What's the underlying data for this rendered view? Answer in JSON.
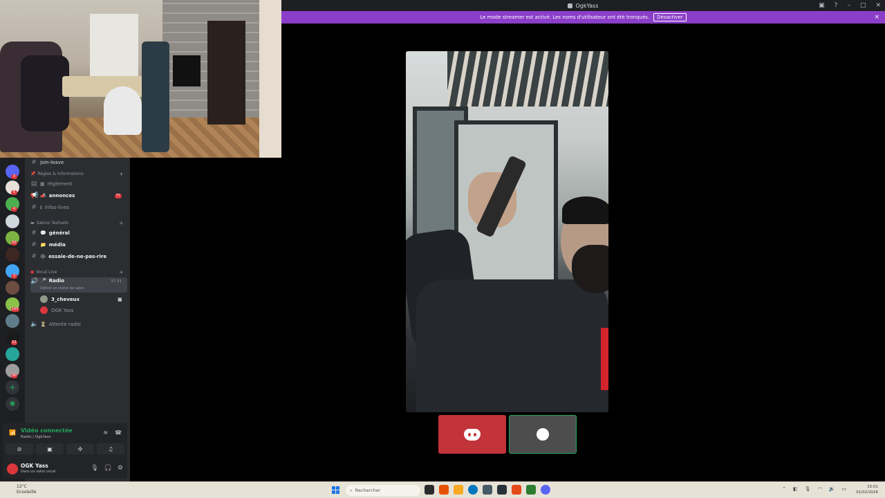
{
  "window": {
    "title": "OgkYass",
    "controls": [
      "inbox-icon",
      "help-icon",
      "minimize-icon",
      "maximize-icon",
      "close-icon"
    ]
  },
  "banner": {
    "text": "Le mode streamer est activé. Les noms d'utilisateur ont été tronqués.",
    "button": "Désactiver",
    "close": "×"
  },
  "rail": {
    "servers": [
      {
        "badge": "3"
      },
      {
        "badge": "6"
      },
      {
        "badge": "4"
      },
      {
        "badge": ""
      },
      {
        "badge": "65"
      },
      {
        "badge": ""
      },
      {
        "badge": "3"
      },
      {
        "badge": ""
      },
      {
        "badge": "165"
      },
      {
        "badge": ""
      },
      {
        "badge": "52"
      },
      {
        "badge": ""
      },
      {
        "badge": "90"
      }
    ]
  },
  "channels": {
    "partial_top": "join-leave",
    "cat_rules": "Règles & Informations",
    "ch_reglement": "règlement",
    "ch_annonces": "annonces",
    "ch_annonces_count": "77",
    "ch_infos": "infos-lives",
    "cat_text": "Salons Textuels",
    "ch_general": "général",
    "ch_media": "média",
    "ch_essaie": "essaie-de-ne-pas-rire",
    "cat_vocal": "Vocal Live",
    "ch_radio": "Radio",
    "ch_radio_time": "37:31",
    "ch_radio_status": "Définir un statut de salon",
    "user1": "3_cheveux",
    "user2": "OGK Yass",
    "ch_attente": "Attente radio"
  },
  "voicepanel": {
    "title": "Vidéo connectée",
    "subtitle": "Radio / OgkYass"
  },
  "user": {
    "name": "OGK Yass",
    "status": "Dans un salon vocal"
  },
  "taskbar": {
    "weather_temp": "12°C",
    "weather_desc": "Ensoleillé",
    "search_placeholder": "Rechercher",
    "time": "15:01",
    "date": "01/02/2026"
  },
  "colors": {
    "banner": "#8b3fc9",
    "accent_green": "#23a55a",
    "discord_red": "#c2333a"
  }
}
